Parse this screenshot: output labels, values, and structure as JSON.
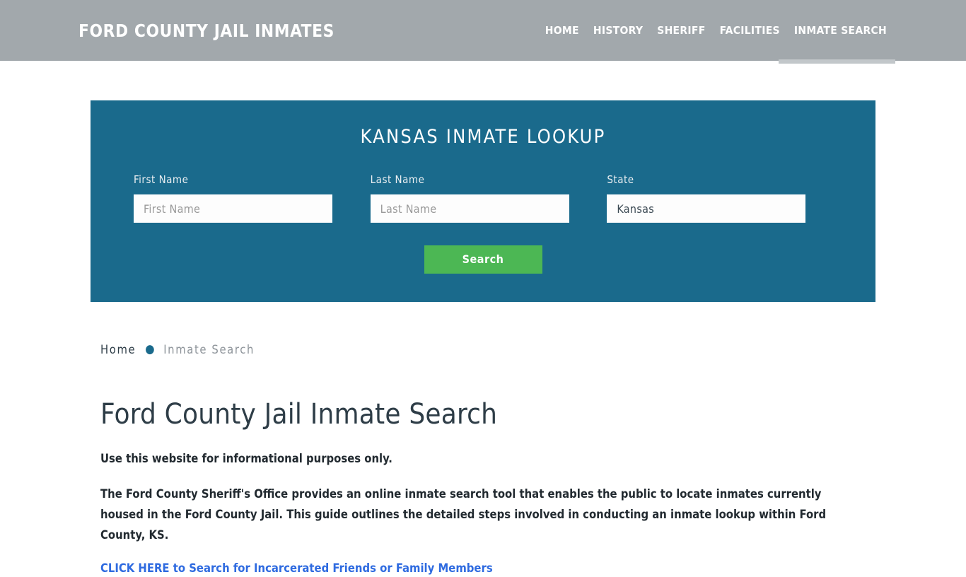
{
  "header": {
    "brand": "FORD COUNTY JAIL INMATES",
    "nav": [
      {
        "label": "HOME",
        "active": false
      },
      {
        "label": "HISTORY",
        "active": false
      },
      {
        "label": "SHERIFF",
        "active": false
      },
      {
        "label": "FACILITIES",
        "active": false
      },
      {
        "label": "INMATE SEARCH",
        "active": true
      }
    ],
    "bg_color": "#a2a8ac"
  },
  "search_panel": {
    "title": "KANSAS INMATE LOOKUP",
    "bg_color": "#1a6a8c",
    "fields": [
      {
        "label": "First Name",
        "placeholder": "First Name",
        "value": ""
      },
      {
        "label": "Last Name",
        "placeholder": "Last Name",
        "value": ""
      },
      {
        "label": "State",
        "placeholder": "",
        "value": "Kansas"
      }
    ],
    "submit_label": "Search",
    "submit_color": "#4cb754"
  },
  "breadcrumb": {
    "home": "Home",
    "separator": "●",
    "current": "Inmate Search"
  },
  "main": {
    "page_title": "Ford County Jail Inmate Search",
    "intro": "Use this website for informational purposes only.",
    "paragraph": "The Ford County Sheriff's Office provides an online inmate search tool that enables the public to locate inmates currently housed in the Ford County Jail. This guide outlines the detailed steps involved in conducting an inmate lookup within Ford County, KS.",
    "cta_link": "CLICK HERE to Search for Incarcerated Friends or Family Members",
    "link_color": "#2f6be0"
  }
}
